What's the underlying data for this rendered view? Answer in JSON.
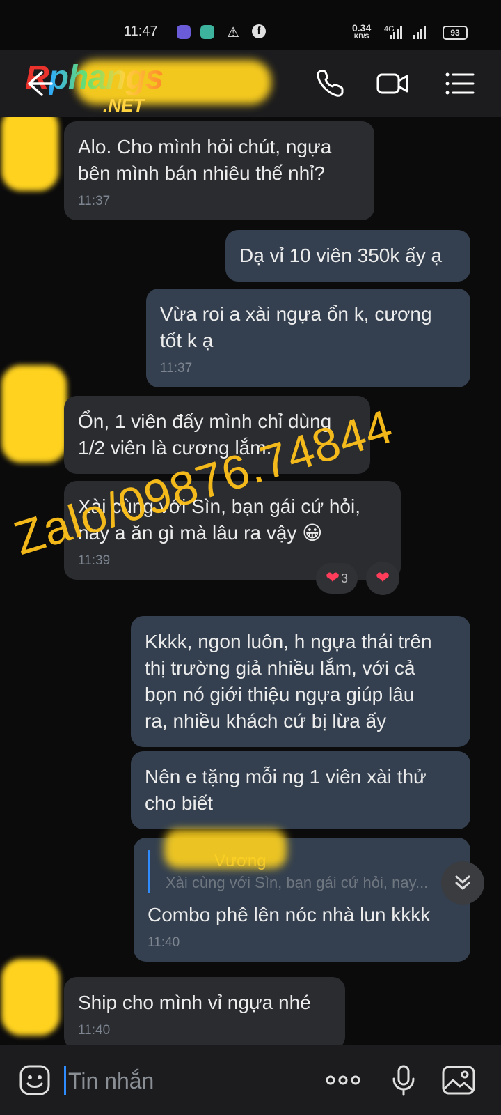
{
  "status_bar": {
    "time": "11:47",
    "net_speed_value": "0.34",
    "net_speed_unit": "KB/S",
    "network_type": "4G",
    "battery": "93"
  },
  "header": {
    "logo_main_r": "R",
    "logo_main_rest": "phangs",
    "logo_sub": ".NET",
    "icons": [
      "back-arrow-icon",
      "phone-icon",
      "video-icon",
      "menu-list-icon"
    ]
  },
  "messages": [
    {
      "side": "in",
      "text": "Alo. Cho mình hỏi chút, ngựa\nbên mình bán nhiêu thế nhỉ?",
      "time": "11:37"
    },
    {
      "side": "out",
      "text": "Dạ vỉ 10 viên 350k ấy ạ",
      "time": ""
    },
    {
      "side": "out",
      "text": "Vừa roi a xài ngựa ổn k, cương\ntốt k ạ",
      "time": "11:37"
    },
    {
      "side": "in",
      "text": "Ổn, 1 viên đấy mình chỉ dùng\n1/2 viên là cương lắm.",
      "time": ""
    },
    {
      "side": "in",
      "text": "Xài cùng với Sìn, bạn gái cứ hỏi,\nnay a ăn gì mà lâu ra vậy 😀",
      "time": "11:39"
    },
    {
      "side": "out",
      "text": "Kkkk, ngon luôn, h ngựa thái trên\nthị trường giả nhiều lắm, với cả\nbọn nó giới thiệu ngựa giúp lâu\nra,  nhiều khách cứ bị lừa ấy",
      "time": ""
    },
    {
      "side": "out",
      "text": "Nên e tặng mỗi ng 1 viên xài thử\ncho biết",
      "time": ""
    },
    {
      "side": "out",
      "text": "Combo phê lên nóc nhà lun kkkk",
      "time": "11:40",
      "quote": {
        "name": "Vương",
        "text": "Xài cùng với Sìn, bạn gái cứ hỏi, nay..."
      }
    },
    {
      "side": "in",
      "text": "Ship cho mình vỉ ngựa nhé",
      "time": "11:40"
    }
  ],
  "reactions": {
    "count": "3"
  },
  "watermark": "Zalo/09876.74844",
  "composer": {
    "placeholder": "Tin nhắn"
  },
  "colors": {
    "incoming": "#2a2c30",
    "outgoing": "#34404f",
    "accent": "#2f8cff",
    "watermark": "#ffc21a"
  }
}
